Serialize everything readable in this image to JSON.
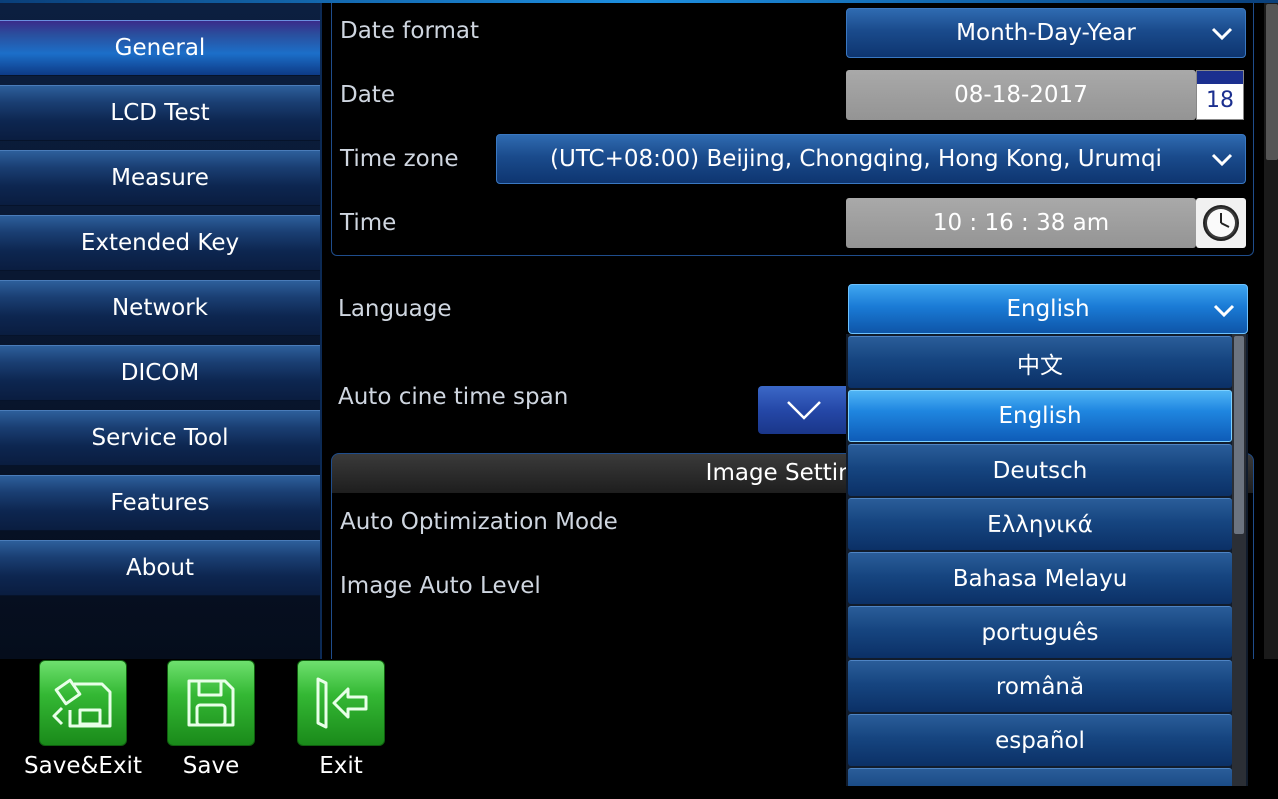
{
  "sidebar": {
    "items": [
      {
        "label": "General",
        "active": true
      },
      {
        "label": "LCD Test"
      },
      {
        "label": "Measure"
      },
      {
        "label": "Extended Key"
      },
      {
        "label": "Network"
      },
      {
        "label": "DICOM"
      },
      {
        "label": "Service Tool"
      },
      {
        "label": "Features"
      },
      {
        "label": "About"
      }
    ]
  },
  "datetime": {
    "date_format_label": "Date format",
    "date_format_value": "Month-Day-Year",
    "date_label": "Date",
    "date_value": "08-18-2017",
    "calendar_day": "18",
    "timezone_label": "Time zone",
    "timezone_value": "(UTC+08:00) Beijing, Chongqing, Hong Kong, Urumqi",
    "time_label": "Time",
    "time_value": "10 : 16 : 38 am"
  },
  "language": {
    "label": "Language",
    "value": "English",
    "options": [
      "中文",
      "English",
      "Deutsch",
      "Ελληνικά",
      "Bahasa Melayu",
      "português",
      "română",
      "español"
    ],
    "selected_index": 1
  },
  "cine": {
    "label": "Auto cine time span"
  },
  "image_settings": {
    "title": "Image Settings",
    "auto_optimization_label": "Auto Optimization Mode",
    "image_auto_level_label": "Image Auto Level"
  },
  "footer": {
    "save_exit_label": "Save&Exit",
    "save_label": "Save",
    "exit_label": "Exit"
  },
  "colors": {
    "accent": "#1f86e0",
    "panel_border": "#1f4d8c",
    "button_green": "#34b834"
  }
}
